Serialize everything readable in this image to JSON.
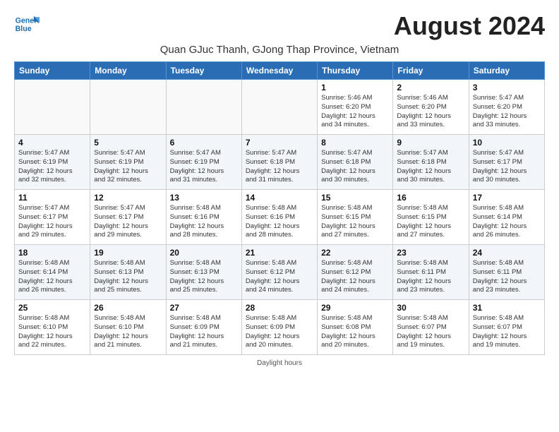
{
  "header": {
    "logo_line1": "General",
    "logo_line2": "Blue",
    "month": "August 2024",
    "subtitle": "Quan GJuc Thanh, GJong Thap Province, Vietnam"
  },
  "days_of_week": [
    "Sunday",
    "Monday",
    "Tuesday",
    "Wednesday",
    "Thursday",
    "Friday",
    "Saturday"
  ],
  "weeks": [
    [
      {
        "day": "",
        "info": ""
      },
      {
        "day": "",
        "info": ""
      },
      {
        "day": "",
        "info": ""
      },
      {
        "day": "",
        "info": ""
      },
      {
        "day": "1",
        "info": "Sunrise: 5:46 AM\nSunset: 6:20 PM\nDaylight: 12 hours\nand 34 minutes."
      },
      {
        "day": "2",
        "info": "Sunrise: 5:46 AM\nSunset: 6:20 PM\nDaylight: 12 hours\nand 33 minutes."
      },
      {
        "day": "3",
        "info": "Sunrise: 5:47 AM\nSunset: 6:20 PM\nDaylight: 12 hours\nand 33 minutes."
      }
    ],
    [
      {
        "day": "4",
        "info": "Sunrise: 5:47 AM\nSunset: 6:19 PM\nDaylight: 12 hours\nand 32 minutes."
      },
      {
        "day": "5",
        "info": "Sunrise: 5:47 AM\nSunset: 6:19 PM\nDaylight: 12 hours\nand 32 minutes."
      },
      {
        "day": "6",
        "info": "Sunrise: 5:47 AM\nSunset: 6:19 PM\nDaylight: 12 hours\nand 31 minutes."
      },
      {
        "day": "7",
        "info": "Sunrise: 5:47 AM\nSunset: 6:18 PM\nDaylight: 12 hours\nand 31 minutes."
      },
      {
        "day": "8",
        "info": "Sunrise: 5:47 AM\nSunset: 6:18 PM\nDaylight: 12 hours\nand 30 minutes."
      },
      {
        "day": "9",
        "info": "Sunrise: 5:47 AM\nSunset: 6:18 PM\nDaylight: 12 hours\nand 30 minutes."
      },
      {
        "day": "10",
        "info": "Sunrise: 5:47 AM\nSunset: 6:17 PM\nDaylight: 12 hours\nand 30 minutes."
      }
    ],
    [
      {
        "day": "11",
        "info": "Sunrise: 5:47 AM\nSunset: 6:17 PM\nDaylight: 12 hours\nand 29 minutes."
      },
      {
        "day": "12",
        "info": "Sunrise: 5:47 AM\nSunset: 6:17 PM\nDaylight: 12 hours\nand 29 minutes."
      },
      {
        "day": "13",
        "info": "Sunrise: 5:48 AM\nSunset: 6:16 PM\nDaylight: 12 hours\nand 28 minutes."
      },
      {
        "day": "14",
        "info": "Sunrise: 5:48 AM\nSunset: 6:16 PM\nDaylight: 12 hours\nand 28 minutes."
      },
      {
        "day": "15",
        "info": "Sunrise: 5:48 AM\nSunset: 6:15 PM\nDaylight: 12 hours\nand 27 minutes."
      },
      {
        "day": "16",
        "info": "Sunrise: 5:48 AM\nSunset: 6:15 PM\nDaylight: 12 hours\nand 27 minutes."
      },
      {
        "day": "17",
        "info": "Sunrise: 5:48 AM\nSunset: 6:14 PM\nDaylight: 12 hours\nand 26 minutes."
      }
    ],
    [
      {
        "day": "18",
        "info": "Sunrise: 5:48 AM\nSunset: 6:14 PM\nDaylight: 12 hours\nand 26 minutes."
      },
      {
        "day": "19",
        "info": "Sunrise: 5:48 AM\nSunset: 6:13 PM\nDaylight: 12 hours\nand 25 minutes."
      },
      {
        "day": "20",
        "info": "Sunrise: 5:48 AM\nSunset: 6:13 PM\nDaylight: 12 hours\nand 25 minutes."
      },
      {
        "day": "21",
        "info": "Sunrise: 5:48 AM\nSunset: 6:12 PM\nDaylight: 12 hours\nand 24 minutes."
      },
      {
        "day": "22",
        "info": "Sunrise: 5:48 AM\nSunset: 6:12 PM\nDaylight: 12 hours\nand 24 minutes."
      },
      {
        "day": "23",
        "info": "Sunrise: 5:48 AM\nSunset: 6:11 PM\nDaylight: 12 hours\nand 23 minutes."
      },
      {
        "day": "24",
        "info": "Sunrise: 5:48 AM\nSunset: 6:11 PM\nDaylight: 12 hours\nand 23 minutes."
      }
    ],
    [
      {
        "day": "25",
        "info": "Sunrise: 5:48 AM\nSunset: 6:10 PM\nDaylight: 12 hours\nand 22 minutes."
      },
      {
        "day": "26",
        "info": "Sunrise: 5:48 AM\nSunset: 6:10 PM\nDaylight: 12 hours\nand 21 minutes."
      },
      {
        "day": "27",
        "info": "Sunrise: 5:48 AM\nSunset: 6:09 PM\nDaylight: 12 hours\nand 21 minutes."
      },
      {
        "day": "28",
        "info": "Sunrise: 5:48 AM\nSunset: 6:09 PM\nDaylight: 12 hours\nand 20 minutes."
      },
      {
        "day": "29",
        "info": "Sunrise: 5:48 AM\nSunset: 6:08 PM\nDaylight: 12 hours\nand 20 minutes."
      },
      {
        "day": "30",
        "info": "Sunrise: 5:48 AM\nSunset: 6:07 PM\nDaylight: 12 hours\nand 19 minutes."
      },
      {
        "day": "31",
        "info": "Sunrise: 5:48 AM\nSunset: 6:07 PM\nDaylight: 12 hours\nand 19 minutes."
      }
    ]
  ],
  "footer": {
    "daylight_note": "Daylight hours"
  }
}
